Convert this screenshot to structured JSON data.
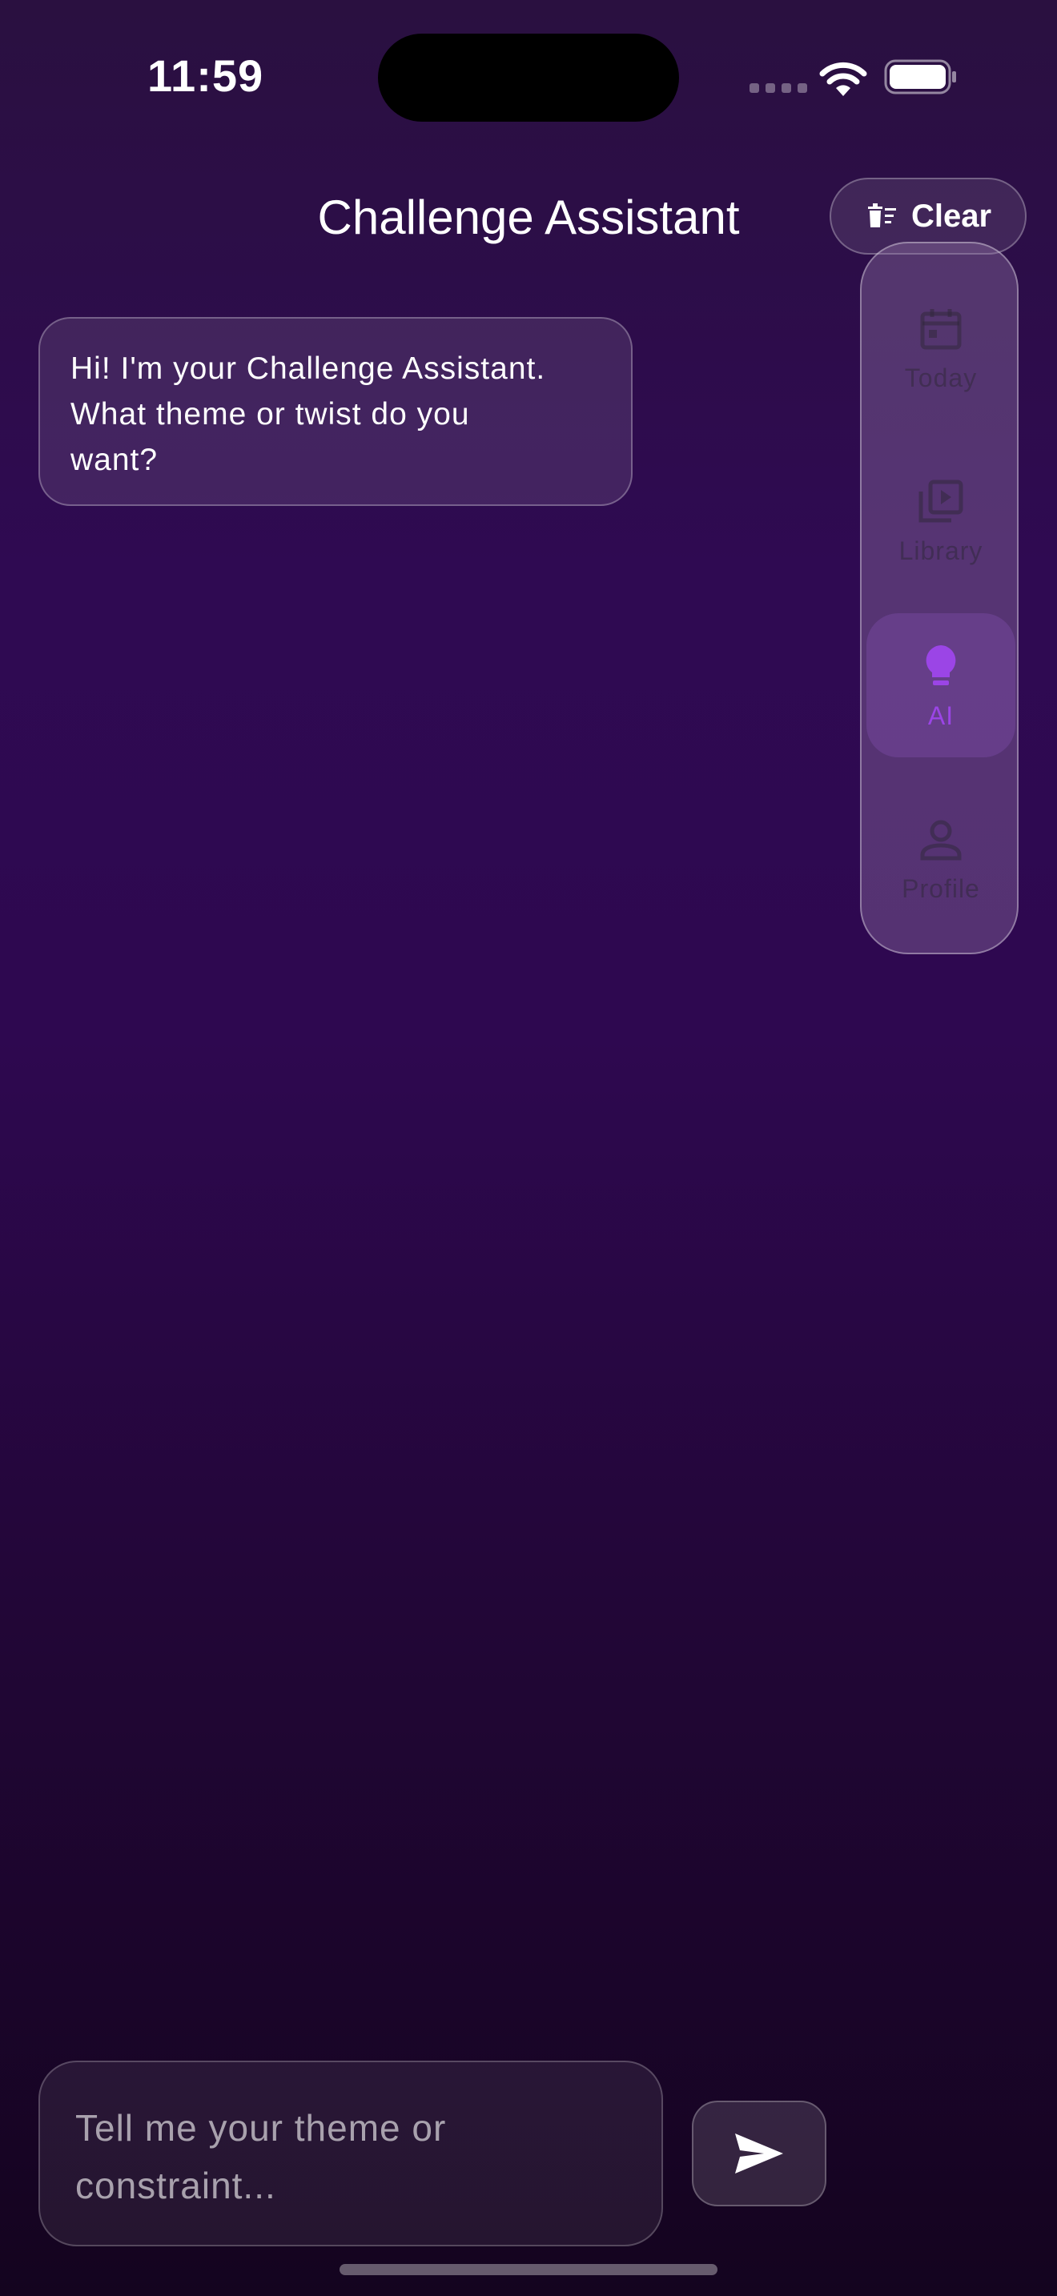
{
  "status_bar": {
    "time": "11:59"
  },
  "header": {
    "title": "Challenge Assistant",
    "clear_label": "Clear",
    "clear_icon": "trash-sort-icon"
  },
  "side_nav": {
    "items": [
      {
        "label": "Today",
        "icon": "calendar-icon",
        "active": false
      },
      {
        "label": "Library",
        "icon": "video-library-icon",
        "active": false
      },
      {
        "label": "AI",
        "icon": "lightbulb-icon",
        "active": true
      },
      {
        "label": "Profile",
        "icon": "person-icon",
        "active": false
      }
    ],
    "active_color": "#9b45e6"
  },
  "chat": {
    "messages": [
      {
        "role": "assistant",
        "lines": [
          "Hi! I'm your Challenge Assistant.",
          "What theme or twist do you",
          "want?"
        ]
      }
    ]
  },
  "composer": {
    "placeholder_lines": [
      "Tell me your theme or",
      "constraint..."
    ],
    "send_icon": "send-icon"
  },
  "colors": {
    "background_top": "#2a1040",
    "background_mid": "#2f0a52",
    "background_bottom": "#14041f"
  }
}
